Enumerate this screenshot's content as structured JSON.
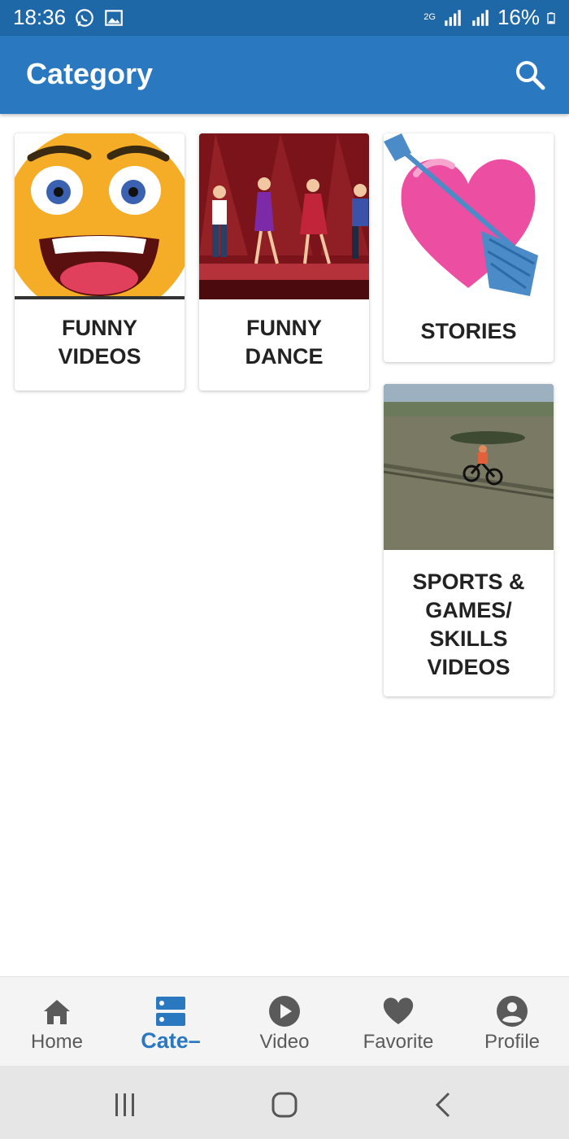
{
  "status_bar": {
    "time": "18:36",
    "battery": "16%",
    "network": "2G"
  },
  "app_bar": {
    "title": "Category",
    "search_icon": "search-icon"
  },
  "categories": [
    {
      "label": "FUNNY\nVIDEOS",
      "thumbnail": "laughing-face"
    },
    {
      "label": "FUNNY\nDANCE",
      "thumbnail": "dancers-stage"
    },
    {
      "label": "STORIES",
      "thumbnail": "heart-arrow"
    },
    {
      "label": "SPORTS &\nGAMES/\nSKILLS\nVIDEOS",
      "thumbnail": "cyclist-water"
    }
  ],
  "bottom_nav": {
    "items": [
      {
        "label": "Home",
        "icon": "home-icon",
        "active": false
      },
      {
        "label": "Cate–",
        "icon": "category-icon",
        "active": true
      },
      {
        "label": "Video",
        "icon": "play-circle-icon",
        "active": false
      },
      {
        "label": "Favorite",
        "icon": "heart-icon",
        "active": false
      },
      {
        "label": "Profile",
        "icon": "account-circle-icon",
        "active": false
      }
    ]
  },
  "colors": {
    "app_bar": "#2a78bf",
    "status_bar": "#1f68a8",
    "active_nav": "#2a78bf",
    "inactive_nav": "#5a5a5a"
  }
}
